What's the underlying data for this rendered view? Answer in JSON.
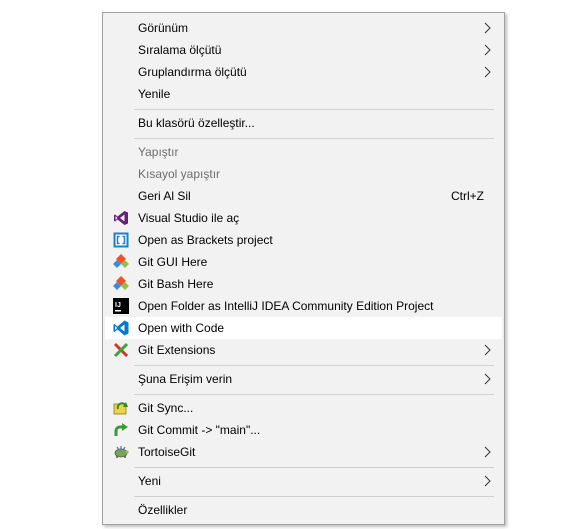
{
  "menu": {
    "items": [
      {
        "label": "Görünüm",
        "submenu": true
      },
      {
        "label": "Sıralama ölçütü",
        "submenu": true
      },
      {
        "label": "Gruplandırma ölçütü",
        "submenu": true
      },
      {
        "label": "Yenile"
      },
      {
        "label": "Bu klasörü özelleştir..."
      },
      {
        "label": "Yapıştır",
        "disabled": true
      },
      {
        "label": "Kısayol yapıştır",
        "disabled": true
      },
      {
        "label": "Geri Al Sil",
        "shortcut": "Ctrl+Z"
      },
      {
        "label": "Visual Studio ile aç",
        "icon": "visual-studio-icon"
      },
      {
        "label": "Open as Brackets project",
        "icon": "brackets-icon"
      },
      {
        "label": "Git GUI Here",
        "icon": "git-gui-icon"
      },
      {
        "label": "Git Bash Here",
        "icon": "git-bash-icon"
      },
      {
        "label": "Open Folder as IntelliJ IDEA Community Edition Project",
        "icon": "intellij-idea-icon"
      },
      {
        "label": "Open with Code",
        "icon": "vscode-icon",
        "highlighted": true
      },
      {
        "label": "Git Extensions",
        "icon": "git-extensions-icon",
        "submenu": true
      },
      {
        "label": "Şuna Erişim verin",
        "submenu": true
      },
      {
        "label": "Git Sync...",
        "icon": "git-sync-icon"
      },
      {
        "label": "Git Commit -> \"main\"...",
        "icon": "git-commit-icon"
      },
      {
        "label": "TortoiseGit",
        "icon": "tortoisegit-icon",
        "submenu": true
      },
      {
        "label": "Yeni",
        "submenu": true
      },
      {
        "label": "Özellikler"
      }
    ]
  },
  "colors": {
    "menu_background": "#f2f2f2",
    "highlight": "#ffffff",
    "disabled_text": "#6d6d6d",
    "separator": "#cfcfcf"
  }
}
